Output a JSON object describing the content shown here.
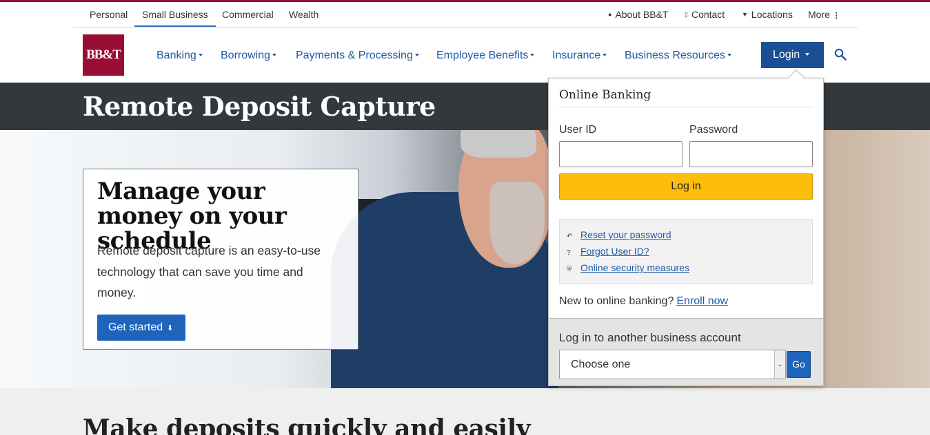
{
  "utility_nav": {
    "segments": [
      "Personal",
      "Small Business",
      "Commercial",
      "Wealth"
    ],
    "active_segment": "Small Business",
    "right_links": [
      {
        "label": "About BB&T",
        "icon": "person-icon"
      },
      {
        "label": "Contact",
        "icon": "phone-icon"
      },
      {
        "label": "Locations",
        "icon": "pin-icon"
      },
      {
        "label": "More",
        "icon": "dots-vertical-icon"
      }
    ]
  },
  "brand": {
    "logo_text": "BB&T",
    "color": "#9b0e33"
  },
  "main_nav": {
    "items": [
      "Banking",
      "Borrowing",
      "Payments & Processing",
      "Employee Benefits",
      "Insurance",
      "Business Resources"
    ],
    "login_label": "Login",
    "accent": "#1c5ba6"
  },
  "page": {
    "title": "Remote Deposit Capture"
  },
  "hero": {
    "heading": "Manage your money on your schedule",
    "body": "Remote deposit capture is an easy-to-use technology that can save you time and money.",
    "cta_label": "Get started",
    "cta_icon": "arrow-down-icon"
  },
  "login_panel": {
    "title": "Online Banking",
    "user_id_label": "User ID",
    "user_id_value": "",
    "password_label": "Password",
    "password_value": "",
    "submit_label": "Log in",
    "help_links": [
      {
        "label": "Reset your password",
        "icon": "refresh-icon"
      },
      {
        "label": "Forgot User ID?",
        "icon": "question-icon"
      },
      {
        "label": "Online security measures",
        "icon": "shield-icon"
      }
    ],
    "enroll_prompt": "New to online banking?",
    "enroll_link": "Enroll now",
    "another_account_label": "Log in to another business account",
    "account_select_value": "Choose one",
    "go_label": "Go"
  },
  "section": {
    "heading": "Make deposits quickly and easily"
  }
}
